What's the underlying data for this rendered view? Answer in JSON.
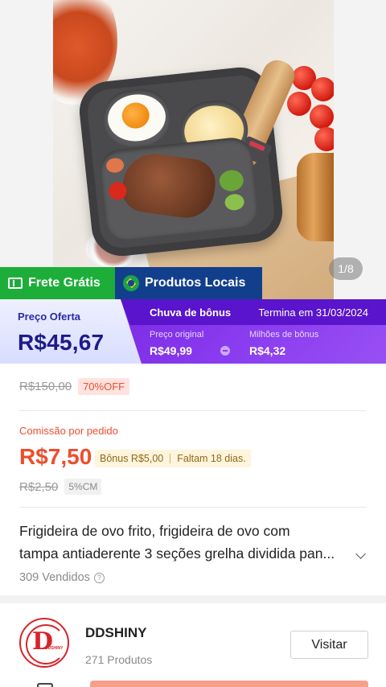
{
  "gallery": {
    "page_indicator": "1/8",
    "icon": "product-photo-frying-pan"
  },
  "badges": {
    "frete_label": "Frete Grátis",
    "frete_icon": "ticket-icon",
    "local_label": "Produtos Locais",
    "local_icon": "brazil-flag-icon"
  },
  "promo": {
    "offer_label": "Preço Oferta",
    "offer_price": "R$45,67",
    "bonus_title": "Chuva de bônus",
    "ends_text": "Termina em 31/03/2024",
    "original_label": "Preço original",
    "original_value": "R$49,99",
    "bonus_label": "Milhões de bônus",
    "bonus_value": "R$4,32"
  },
  "pricing": {
    "old_price": "R$150,00",
    "discount": "70%OFF"
  },
  "commission": {
    "label": "Comissão por pedido",
    "value": "R$7,50",
    "bonus": "Bônus R$5,00",
    "days_left": "Faltam 18 dias.",
    "old_value": "R$2,50",
    "rate": "5%CM"
  },
  "product": {
    "title_line1": "Frigideira de ovo frito, frigideira de ovo com",
    "title_line2": "tampa antiaderente 3 seções grelha dividida pan...",
    "sold": "309 Vendidos"
  },
  "shop": {
    "logo_letter": "D",
    "logo_text": "DDSHINY",
    "name": "DDSHINY",
    "products": "271 Produtos",
    "visit_label": "Visitar"
  },
  "colors": {
    "accent": "#ee4d2d",
    "frete_green": "#1dae3a",
    "local_blue": "#123f8c",
    "promo_purple": "#8a3cf0"
  }
}
